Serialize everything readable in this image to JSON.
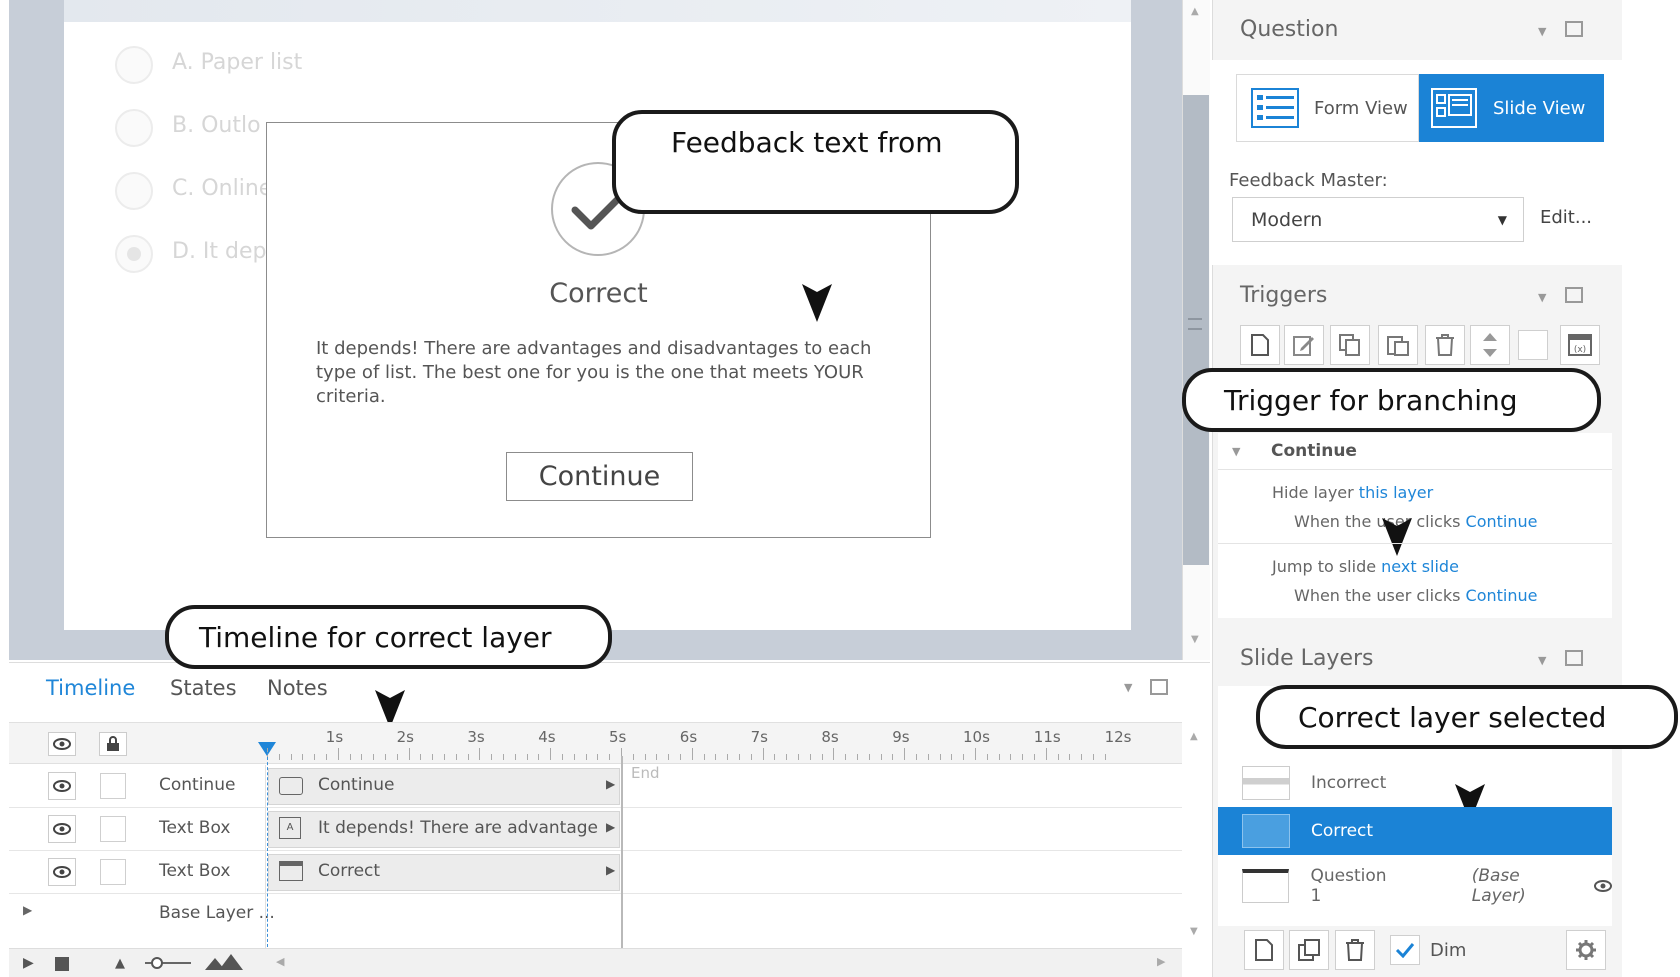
{
  "slide": {
    "options": [
      "A. Paper list",
      "B. Outlo",
      "C. Online",
      "D. It dep"
    ],
    "feedback": {
      "title": "Correct",
      "body": "It depends!  There are advantages and disadvantages to each type of list.  The best one for you is the one that meets YOUR criteria.",
      "continue_label": "Continue"
    }
  },
  "callouts": {
    "feedback_text": "Feedback text from",
    "trigger": "Trigger for branching",
    "timeline": "Timeline for correct layer",
    "layer_selected": "Correct layer selected"
  },
  "bottom": {
    "tabs": [
      "Timeline",
      "States",
      "Notes"
    ],
    "ticks": [
      "1s",
      "2s",
      "3s",
      "4s",
      "5s",
      "6s",
      "7s",
      "8s",
      "9s",
      "10s",
      "11s",
      "12s"
    ],
    "end_label": "End",
    "rows": [
      {
        "name": "Continue",
        "bar": "Continue"
      },
      {
        "name": "Text Box",
        "bar": "It depends! There are advantages a..."
      },
      {
        "name": "Text Box",
        "bar": "Correct"
      },
      {
        "name": "Base Layer ..."
      }
    ]
  },
  "right": {
    "question": {
      "title": "Question",
      "form_view": "Form View",
      "slide_view": "Slide View",
      "feedback_master_label": "Feedback Master:",
      "feedback_master_value": "Modern",
      "edit_label": "Edit..."
    },
    "triggers": {
      "title": "Triggers",
      "group": "Continue",
      "items": [
        {
          "action_prefix": "Hide layer ",
          "action_link": "this layer",
          "cond_prefix": "When the user clicks ",
          "cond_link": "Continue"
        },
        {
          "action_prefix": "Jump to slide ",
          "action_link": "next slide",
          "cond_prefix": "When the user clicks ",
          "cond_link": "Continue"
        }
      ]
    },
    "layers": {
      "title": "Slide Layers",
      "items": [
        {
          "name": "Incorrect",
          "note": ""
        },
        {
          "name": "Correct",
          "note": ""
        },
        {
          "name": "Question 1",
          "note": "(Base Layer)"
        }
      ],
      "dim_label": "Dim"
    }
  },
  "colors": {
    "accent": "#1b83d6",
    "link": "#1f86d8",
    "callout_border": "#1a1a1a"
  }
}
